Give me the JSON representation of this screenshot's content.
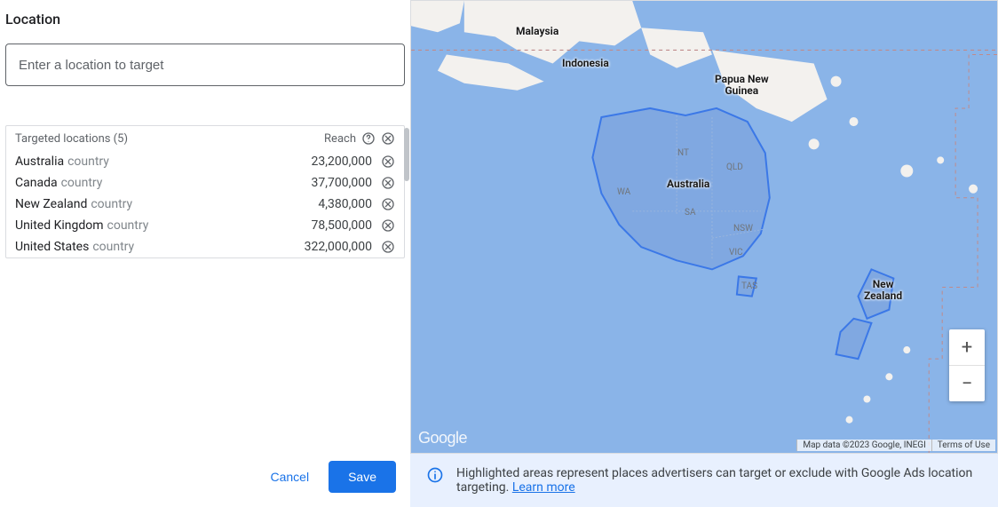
{
  "section": {
    "title": "Location"
  },
  "search": {
    "placeholder": "Enter a location to target"
  },
  "targeted": {
    "header_label": "Targeted locations (5)",
    "reach_label": "Reach",
    "rows": [
      {
        "name": "Australia",
        "type": "country",
        "reach": "23,200,000"
      },
      {
        "name": "Canada",
        "type": "country",
        "reach": "37,700,000"
      },
      {
        "name": "New Zealand",
        "type": "country",
        "reach": "4,380,000"
      },
      {
        "name": "United Kingdom",
        "type": "country",
        "reach": "78,500,000"
      },
      {
        "name": "United States",
        "type": "country",
        "reach": "322,000,000"
      }
    ]
  },
  "actions": {
    "cancel": "Cancel",
    "save": "Save"
  },
  "map": {
    "labels": {
      "malaysia": "Malaysia",
      "indonesia": "Indonesia",
      "png": "Papua New\nGuinea",
      "australia": "Australia",
      "nz": "New\nZealand"
    },
    "regions": {
      "nt": "NT",
      "qld": "QLD",
      "wa": "WA",
      "sa": "SA",
      "nsw": "NSW",
      "vic": "VIC",
      "tas": "TAS"
    },
    "watermark": "Google",
    "attrib_data": "Map data ©2023 Google, INEGI",
    "attrib_terms": "Terms of Use",
    "zoom_in": "+",
    "zoom_out": "−"
  },
  "banner": {
    "text": "Highlighted areas represent places advertisers can target or exclude with Google Ads location targeting. ",
    "learn_more": "Learn more"
  }
}
